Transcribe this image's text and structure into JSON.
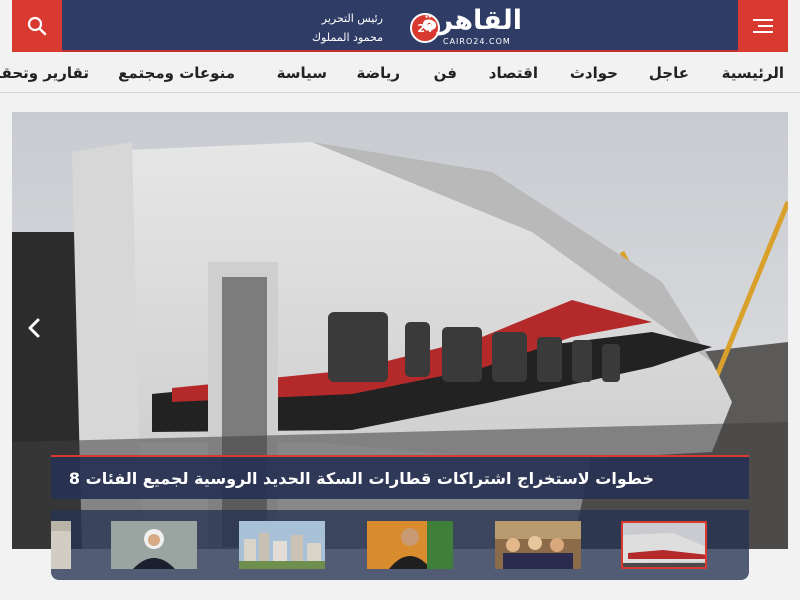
{
  "header": {
    "editor_title": "رئيس التحرير",
    "editor_name": "محمود المملوك",
    "logo_text": "القاهرة",
    "logo_number": "24",
    "logo_domain": "CAIRO24.COM"
  },
  "nav": {
    "items": [
      {
        "label": "الرئيسية"
      },
      {
        "label": "عاجل"
      },
      {
        "label": "حوادث"
      },
      {
        "label": "اقتصاد"
      },
      {
        "label": "فن"
      },
      {
        "label": "رياضة"
      },
      {
        "label": "سياسة"
      },
      {
        "label": "منوعات ومجتمع"
      },
      {
        "label": "تقارير وتحقيقات"
      }
    ]
  },
  "hero": {
    "headline": "8 خطوات لاستخراج اشتراكات قطارات السكة الحديد الروسية لجميع الفئات",
    "thumbnails": [
      {
        "name": "train-thumb",
        "active": true
      },
      {
        "name": "meeting-thumb",
        "active": false
      },
      {
        "name": "man-thumb",
        "active": false
      },
      {
        "name": "city-thumb",
        "active": false
      },
      {
        "name": "woman-thumb",
        "active": false
      },
      {
        "name": "partial-thumb",
        "active": false
      }
    ]
  },
  "colors": {
    "header_bg": "#2f3d66",
    "accent_red": "#d83a2f",
    "page_bg": "#f2f2f2"
  },
  "icons": [
    "menu-icon",
    "search-icon",
    "chevron-left-icon"
  ]
}
